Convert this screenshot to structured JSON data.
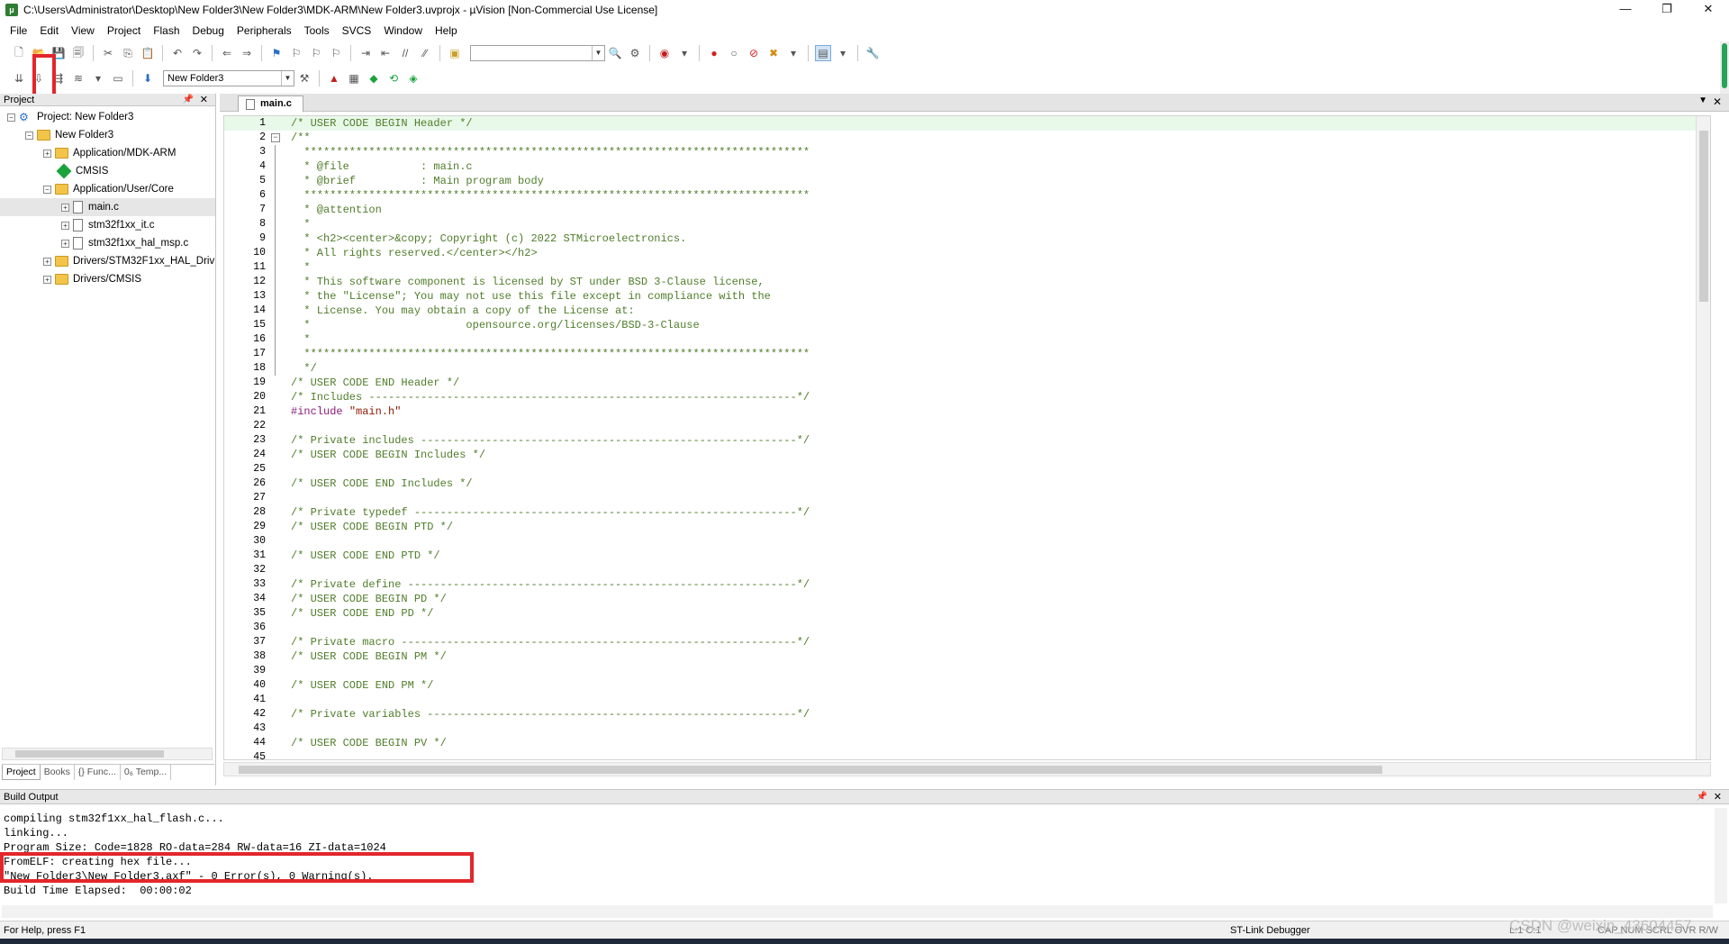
{
  "window": {
    "title": "C:\\Users\\Administrator\\Desktop\\New Folder3\\New Folder3\\MDK-ARM\\New Folder3.uvprojx - µVision  [Non-Commercial Use License]",
    "minimize": "—",
    "maximize": "❐",
    "close": "✕"
  },
  "menu": [
    "File",
    "Edit",
    "View",
    "Project",
    "Flash",
    "Debug",
    "Peripherals",
    "Tools",
    "SVCS",
    "Window",
    "Help"
  ],
  "toolbar2": {
    "target_combo": "New Folder3"
  },
  "project_panel": {
    "title": "Project",
    "tree": [
      {
        "label": "Project: New Folder3",
        "level": 0,
        "type": "project"
      },
      {
        "label": "New Folder3",
        "level": 1,
        "type": "folder"
      },
      {
        "label": "Application/MDK-ARM",
        "level": 2,
        "type": "folder"
      },
      {
        "label": "CMSIS",
        "level": 2,
        "type": "gem"
      },
      {
        "label": "Application/User/Core",
        "level": 2,
        "type": "folder"
      },
      {
        "label": "main.c",
        "level": 3,
        "type": "file",
        "selected": true
      },
      {
        "label": "stm32f1xx_it.c",
        "level": 3,
        "type": "file"
      },
      {
        "label": "stm32f1xx_hal_msp.c",
        "level": 3,
        "type": "file"
      },
      {
        "label": "Drivers/STM32F1xx_HAL_Driv",
        "level": 2,
        "type": "folder"
      },
      {
        "label": "Drivers/CMSIS",
        "level": 2,
        "type": "folder"
      }
    ],
    "tabs": [
      "Project",
      "Books",
      "{} Func...",
      "0₆ Temp..."
    ]
  },
  "editor": {
    "tab": "main.c",
    "lines": [
      "/* USER CODE BEGIN Header */",
      "/**",
      "  ******************************************************************************",
      "  * @file           : main.c",
      "  * @brief          : Main program body",
      "  ******************************************************************************",
      "  * @attention",
      "  *",
      "  * <h2><center>&copy; Copyright (c) 2022 STMicroelectronics.",
      "  * All rights reserved.</center></h2>",
      "  *",
      "  * This software component is licensed by ST under BSD 3-Clause license,",
      "  * the \"License\"; You may not use this file except in compliance with the",
      "  * License. You may obtain a copy of the License at:",
      "  *                        opensource.org/licenses/BSD-3-Clause",
      "  *",
      "  ******************************************************************************",
      "  */",
      "/* USER CODE END Header */",
      "/* Includes ------------------------------------------------------------------*/",
      "#include \"main.h\"",
      "",
      "/* Private includes ----------------------------------------------------------*/",
      "/* USER CODE BEGIN Includes */",
      "",
      "/* USER CODE END Includes */",
      "",
      "/* Private typedef -----------------------------------------------------------*/",
      "/* USER CODE BEGIN PTD */",
      "",
      "/* USER CODE END PTD */",
      "",
      "/* Private define ------------------------------------------------------------*/",
      "/* USER CODE BEGIN PD */",
      "/* USER CODE END PD */",
      "",
      "/* Private macro -------------------------------------------------------------*/",
      "/* USER CODE BEGIN PM */",
      "",
      "/* USER CODE END PM */",
      "",
      "/* Private variables ---------------------------------------------------------*/",
      "",
      "/* USER CODE BEGIN PV */",
      ""
    ]
  },
  "build_output": {
    "title": "Build Output",
    "lines": [
      "compiling stm32f1xx_hal_flash.c...",
      "linking...",
      "Program Size: Code=1828 RO-data=284 RW-data=16 ZI-data=1024",
      "FromELF: creating hex file...",
      "\"New Folder3\\New Folder3.axf\" - 0 Error(s), 0 Warning(s).",
      "Build Time Elapsed:  00:00:02"
    ]
  },
  "status": {
    "help": "For Help, press F1",
    "debugger": "ST-Link Debugger",
    "position": "L:1 C:1",
    "caps": "CAP NUM SCRL OVR R/W"
  },
  "watermark": "CSDN @weixin_43604457",
  "colors": {
    "highlight_box": "#e3262b",
    "comment": "#4f7d2a",
    "preprocessor": "#8c1a7a",
    "string": "#8c1a00",
    "current_line": "#e9f9e9"
  }
}
